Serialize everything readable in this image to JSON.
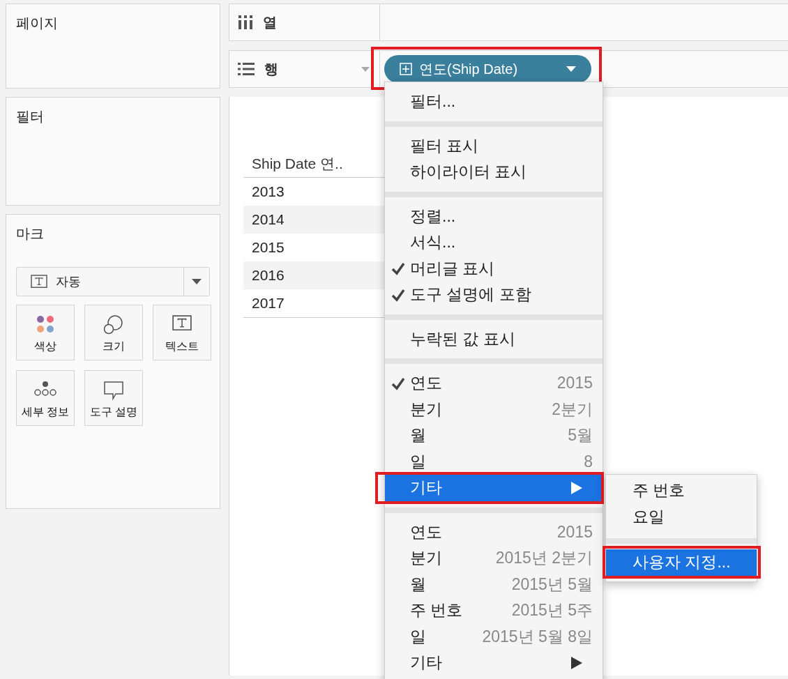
{
  "pages_card": {
    "title": "페이지"
  },
  "filters_card": {
    "title": "필터"
  },
  "marks_card": {
    "title": "마크",
    "mark_type": "자동",
    "buttons": [
      {
        "kind": "color",
        "label": "색상"
      },
      {
        "kind": "size",
        "label": "크기"
      },
      {
        "kind": "text",
        "label": "텍스트"
      },
      {
        "kind": "detail",
        "label": "세부 정보"
      },
      {
        "kind": "tooltip",
        "label": "도구 설명"
      }
    ]
  },
  "columns_shelf": {
    "label": "열"
  },
  "rows_shelf": {
    "label": "행",
    "pill": {
      "label": "연도(Ship Date)",
      "highlighted": true
    }
  },
  "table": {
    "header": "Ship Date 연..",
    "rows": [
      "2013",
      "2014",
      "2015",
      "2016",
      "2017"
    ]
  },
  "menu": {
    "sections": [
      [
        {
          "label": "필터...",
          "checked": false,
          "selected": false,
          "highlighted": false
        }
      ],
      [
        {
          "label": "필터 표시",
          "checked": false,
          "selected": false,
          "highlighted": false
        },
        {
          "label": "하이라이터 표시",
          "checked": false,
          "selected": false,
          "highlighted": false
        }
      ],
      [
        {
          "label": "정렬...",
          "checked": false,
          "selected": false,
          "highlighted": false
        },
        {
          "label": "서식...",
          "checked": false,
          "selected": false,
          "highlighted": false
        },
        {
          "label": "머리글 표시",
          "checked": true,
          "selected": false,
          "highlighted": false
        },
        {
          "label": "도구 설명에 포함",
          "checked": true,
          "selected": false,
          "highlighted": false
        }
      ],
      [
        {
          "label": "누락된 값 표시",
          "checked": false,
          "selected": false,
          "highlighted": false
        }
      ],
      [
        {
          "label": "연도",
          "value": "2015",
          "checked": true,
          "selected": false,
          "highlighted": false
        },
        {
          "label": "분기",
          "value": "2분기",
          "checked": false,
          "selected": false,
          "highlighted": false
        },
        {
          "label": "월",
          "value": "5월",
          "checked": false,
          "selected": false,
          "highlighted": false
        },
        {
          "label": "일",
          "value": "8",
          "checked": false,
          "selected": false,
          "highlighted": false
        },
        {
          "label": "기타",
          "kind": "submenu",
          "checked": false,
          "selected": true,
          "highlighted": true
        }
      ],
      [
        {
          "label": "연도",
          "value": "2015",
          "checked": false,
          "selected": false,
          "highlighted": false
        },
        {
          "label": "분기",
          "value": "2015년 2분기",
          "checked": false,
          "selected": false,
          "highlighted": false
        },
        {
          "label": "월",
          "value": "2015년 5월",
          "checked": false,
          "selected": false,
          "highlighted": false
        },
        {
          "label": "주 번호",
          "value": "2015년 5주",
          "checked": false,
          "selected": false,
          "highlighted": false
        },
        {
          "label": "일",
          "value": "2015년 5월 8일",
          "checked": false,
          "selected": false,
          "highlighted": false
        },
        {
          "label": "기타",
          "kind": "submenu",
          "checked": false,
          "selected": false,
          "highlighted": false
        }
      ]
    ]
  },
  "submenu": {
    "sections": [
      [
        {
          "label": "주 번호",
          "selected": false,
          "highlighted": false
        },
        {
          "label": "요일",
          "selected": false,
          "highlighted": false
        }
      ],
      [
        {
          "label": "사용자 지정...",
          "selected": true,
          "highlighted": true
        }
      ]
    ]
  }
}
